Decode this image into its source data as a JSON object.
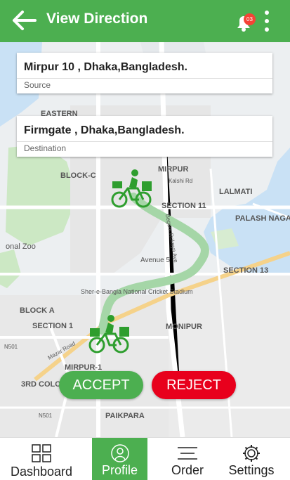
{
  "header": {
    "title": "View Direction",
    "notification_count": "03",
    "back_icon": "arrow-left-icon",
    "bell_icon": "bell-icon",
    "more_icon": "more-vert-icon"
  },
  "source": {
    "address": "Mirpur 10 , Dhaka,Bangladesh.",
    "label": "Source"
  },
  "destination": {
    "address": "Firmgate , Dhaka,Bangladesh.",
    "label": "Destination"
  },
  "map": {
    "area_labels": [
      "EASTERN",
      "BLOCK-C",
      "MIRPUR",
      "LALMATI",
      "SECTION 11",
      "PALASH NAGAR",
      "onal Zoo",
      "Avenue 5",
      "SECTION 13",
      "BLOCK A",
      "SECTION 1",
      "MONIPUR",
      "MIRPUR-1",
      "3RD COLO",
      "PAIKPARA",
      "N501",
      "N501",
      "Kalshi Rd",
      "Begum Rokeya Ave",
      "Mazar Road",
      "Sher-e-Bangla National Cricket Stadium"
    ],
    "route_color": "#a5d6a7"
  },
  "actions": {
    "accept": "ACCEPT",
    "reject": "REJECT"
  },
  "tabs": [
    {
      "label": "Dashboard",
      "icon": "grid-icon",
      "active": false
    },
    {
      "label": "Profile",
      "icon": "user-icon",
      "active": true
    },
    {
      "label": "Order",
      "icon": "menu-icon",
      "active": false
    },
    {
      "label": "Settings",
      "icon": "gear-icon",
      "active": false
    }
  ],
  "colors": {
    "primary": "#4caf50",
    "reject": "#e8001c",
    "badge": "#f44336"
  }
}
